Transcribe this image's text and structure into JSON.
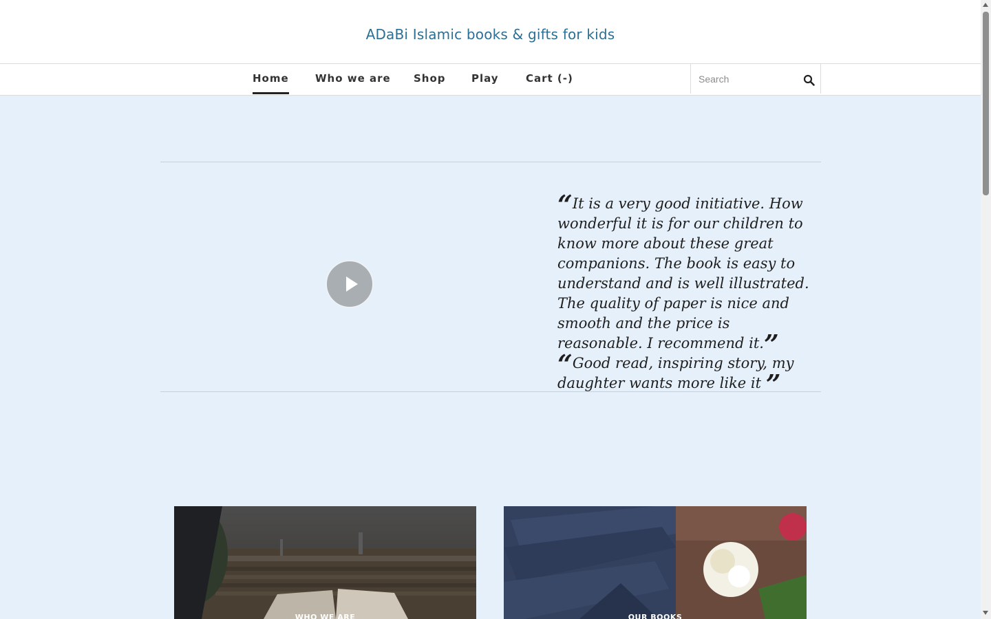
{
  "site": {
    "title": "ADaBi Islamic books & gifts for kids"
  },
  "nav": {
    "items": [
      {
        "label": "Home",
        "active": true
      },
      {
        "label": "Who we are",
        "active": false
      },
      {
        "label": "Shop",
        "active": false
      },
      {
        "label": "Play",
        "active": false
      },
      {
        "label": "Cart (-)",
        "active": false
      }
    ]
  },
  "search": {
    "placeholder": "Search",
    "value": ""
  },
  "video": {
    "icon": "play-icon"
  },
  "testimonials": [
    {
      "text": "It is a very good initiative. How wonderful it is for our children to know more about these great companions. The book is easy to understand and is well illustrated. The quality of paper is nice and smooth and the price is reasonable. I recommend it."
    },
    {
      "text": "Good read, inspiring story, my daughter wants more like it"
    }
  ],
  "cards": [
    {
      "label": "WHO WE ARE"
    },
    {
      "label": "OUR BOOKS"
    }
  ],
  "colors": {
    "background": "#e6f0fa",
    "title": "#2b6f94",
    "nav_text": "#333333"
  }
}
